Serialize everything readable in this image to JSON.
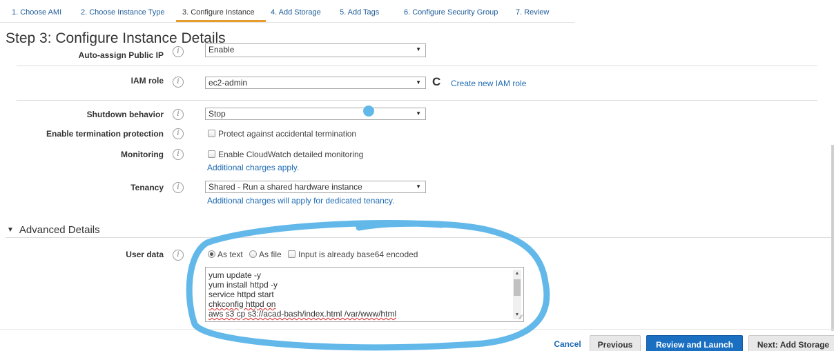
{
  "steps": [
    {
      "label": "1. Choose AMI",
      "active": false
    },
    {
      "label": "2. Choose Instance Type",
      "active": false
    },
    {
      "label": "3. Configure Instance",
      "active": true
    },
    {
      "label": "4. Add Storage",
      "active": false
    },
    {
      "label": "5. Add Tags",
      "active": false
    },
    {
      "label": "6. Configure Security Group",
      "active": false
    },
    {
      "label": "7. Review",
      "active": false
    }
  ],
  "page_title": "Step 3: Configure Instance Details",
  "form": {
    "public_ip": {
      "label": "Auto-assign Public IP",
      "value": "Enable"
    },
    "iam_role": {
      "label": "IAM role",
      "value": "ec2-admin",
      "create_link": "Create new IAM role"
    },
    "shutdown": {
      "label": "Shutdown behavior",
      "value": "Stop"
    },
    "termination": {
      "label": "Enable termination protection",
      "checkbox_label": "Protect against accidental termination",
      "checked": false
    },
    "monitoring": {
      "label": "Monitoring",
      "checkbox_label": "Enable CloudWatch detailed monitoring",
      "checked": false,
      "note": "Additional charges apply."
    },
    "tenancy": {
      "label": "Tenancy",
      "value": "Shared - Run a shared hardware instance",
      "note": "Additional charges will apply for dedicated tenancy."
    }
  },
  "advanced": {
    "title": "Advanced Details",
    "user_data_label": "User data",
    "as_text": "As text",
    "as_file": "As file",
    "as_text_selected": true,
    "base64_label": "Input is already base64 encoded",
    "base64_checked": false,
    "user_data_lines": [
      "yum update -y",
      "yum install httpd -y",
      "service httpd start",
      "chkconfig httpd on",
      "aws s3 cp s3://acad-bash/index.html /var/www/html"
    ]
  },
  "buttons": {
    "cancel": "Cancel",
    "previous": "Previous",
    "review": "Review and Launch",
    "next": "Next: Add Storage"
  },
  "icons": {
    "info": "info-icon",
    "refresh": "refresh-icon",
    "dropdown": "caret-down-icon",
    "toggle": "triangle-down-icon"
  },
  "colors": {
    "link": "#1f6bb3",
    "active_tab_underline": "#e89d2b",
    "primary_button": "#1a6fc1",
    "annotation": "#63b8ea"
  }
}
